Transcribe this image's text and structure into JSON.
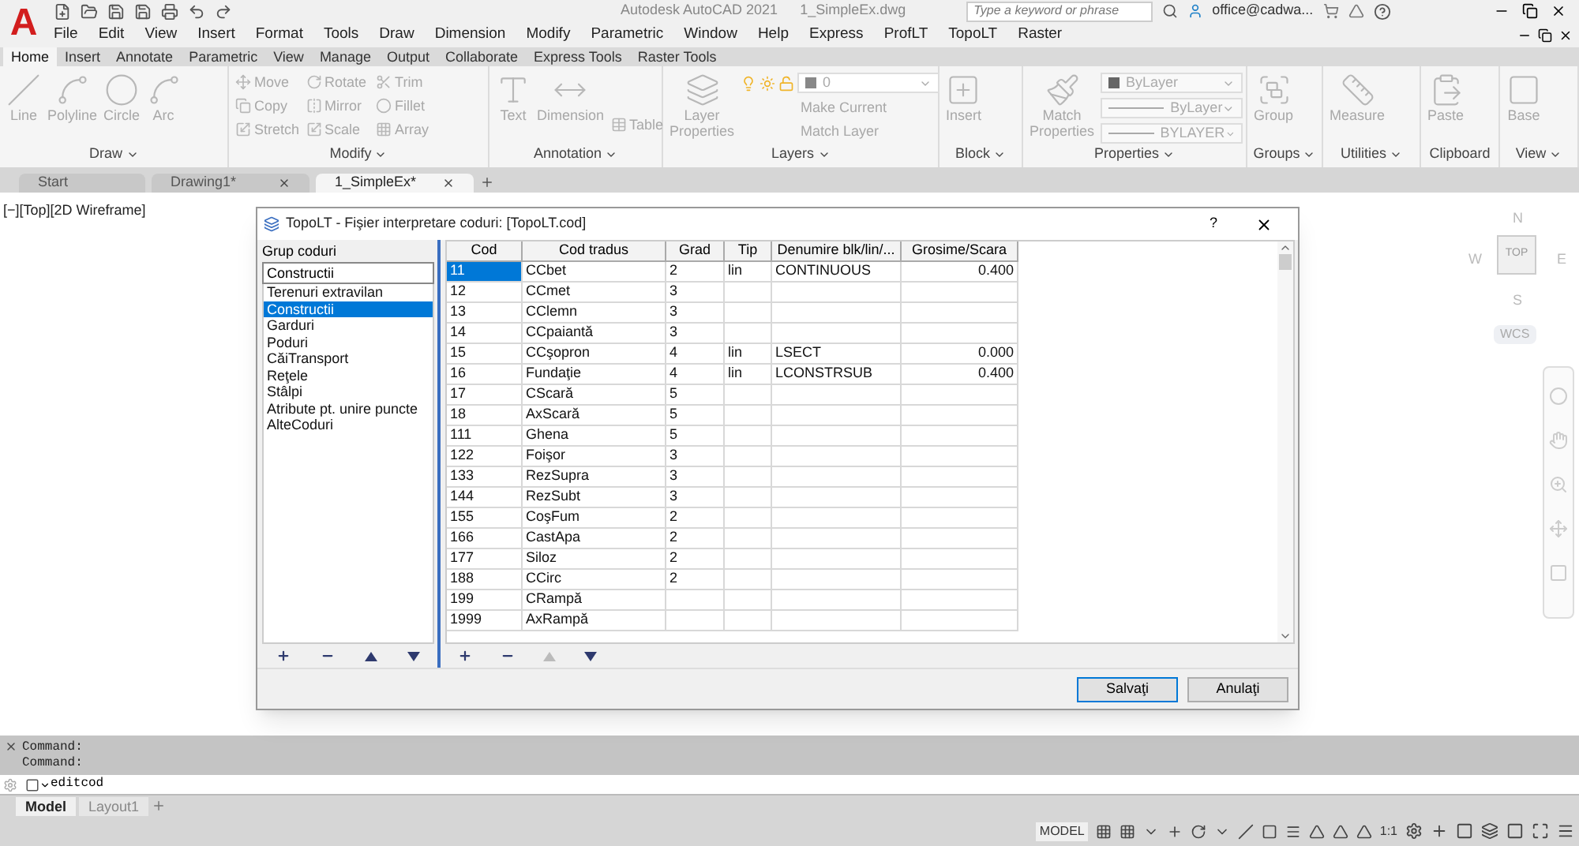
{
  "app": {
    "logo": "A",
    "title": "Autodesk AutoCAD 2021",
    "file": "1_SimpleEx.dwg",
    "search": {
      "placeholder": "Type a keyword or phrase"
    },
    "user": "office@cadwa..."
  },
  "menu": [
    "File",
    "Edit",
    "View",
    "Insert",
    "Format",
    "Tools",
    "Draw",
    "Dimension",
    "Modify",
    "Parametric",
    "Window",
    "Help",
    "Express",
    "ProfLT",
    "TopoLT",
    "Raster"
  ],
  "ribbon": {
    "disabled": true,
    "tabs": [
      {
        "label": "Home",
        "selected": true
      },
      {
        "label": "Insert",
        "selected": false
      },
      {
        "label": "Annotate",
        "selected": false
      },
      {
        "label": "Parametric",
        "selected": false
      },
      {
        "label": "View",
        "selected": false
      },
      {
        "label": "Manage",
        "selected": false
      },
      {
        "label": "Output",
        "selected": false
      },
      {
        "label": "Collaborate",
        "selected": false
      },
      {
        "label": "Express Tools",
        "selected": false
      },
      {
        "label": "Raster Tools",
        "selected": false
      }
    ],
    "panels": [
      {
        "title": "Draw",
        "menu": true,
        "large": [
          "Line",
          "Polyline",
          "Circle",
          "Arc"
        ]
      },
      {
        "title": "Modify",
        "menu": true,
        "small": [
          "Move",
          "Rotate",
          "Trim",
          "Copy",
          "Mirror",
          "Fillet",
          "Stretch",
          "Scale",
          "Array"
        ]
      },
      {
        "title": "Annotation",
        "menu": true,
        "large": [
          "Text",
          "Dimension"
        ],
        "small": [
          "Table"
        ]
      },
      {
        "title": "Layers",
        "menu": true,
        "large": [
          "Layer Properties"
        ],
        "combo": "0",
        "small": [
          "Make Current",
          "Match Layer"
        ]
      },
      {
        "title": "Block",
        "menu": true,
        "large": [
          "Insert"
        ]
      },
      {
        "title": "Properties",
        "menu": true,
        "large": [
          "Match Properties"
        ],
        "combos": [
          "ByLayer",
          "ByLayer",
          "BYLAYER"
        ]
      },
      {
        "title": "Groups",
        "menu": true,
        "large": [
          "Group"
        ]
      },
      {
        "title": "Utilities",
        "menu": true,
        "large": [
          "Measure"
        ]
      },
      {
        "title": "Clipboard",
        "menu": false,
        "large": [
          "Paste"
        ]
      },
      {
        "title": "View",
        "menu": true,
        "large": [
          "Base"
        ]
      }
    ]
  },
  "doc_tabs": [
    {
      "label": "Start",
      "selected": false,
      "closable": false
    },
    {
      "label": "Drawing1*",
      "selected": false,
      "closable": true
    },
    {
      "label": "1_SimpleEx*",
      "selected": true,
      "closable": true
    }
  ],
  "viewport": {
    "label": "[−][Top][2D Wireframe]",
    "viewcube": {
      "n": "N",
      "w": "W",
      "e": "E",
      "s": "S",
      "face": "TOP",
      "ucs": "WCS"
    }
  },
  "dialog": {
    "title": "TopoLT - Fişier interpretare coduri: [TopoLT.cod]",
    "help": "?",
    "group_label": "Grup coduri",
    "group_value": "Constructii",
    "groups": [
      {
        "label": "Terenuri extravilan",
        "selected": false
      },
      {
        "label": "Constructii",
        "selected": true
      },
      {
        "label": "Garduri",
        "selected": false
      },
      {
        "label": "Poduri",
        "selected": false
      },
      {
        "label": "CăiTransport",
        "selected": false
      },
      {
        "label": "Reţele",
        "selected": false
      },
      {
        "label": "Stâlpi",
        "selected": false
      },
      {
        "label": "Atribute pt. unire puncte",
        "selected": false
      },
      {
        "label": "AlteCoduri",
        "selected": false
      }
    ],
    "columns": [
      "Cod",
      "Cod tradus",
      "Grad",
      "Tip",
      "Denumire blk/lin/...",
      "Grosime/Scara"
    ],
    "rows": [
      {
        "cells": [
          "11",
          "CCbet",
          "2",
          "lin",
          "CONTINUOUS",
          "0.400"
        ],
        "selected": true
      },
      {
        "cells": [
          "12",
          "CCmet",
          "3",
          "",
          "",
          ""
        ],
        "selected": false
      },
      {
        "cells": [
          "13",
          "CClemn",
          "3",
          "",
          "",
          ""
        ],
        "selected": false
      },
      {
        "cells": [
          "14",
          "CCpaiantă",
          "3",
          "",
          "",
          ""
        ],
        "selected": false
      },
      {
        "cells": [
          "15",
          "CCşopron",
          "4",
          "lin",
          "LSECT",
          "0.000"
        ],
        "selected": false
      },
      {
        "cells": [
          "16",
          "Fundaţie",
          "4",
          "lin",
          "LCONSTRSUB",
          "0.400"
        ],
        "selected": false
      },
      {
        "cells": [
          "17",
          "CScară",
          "5",
          "",
          "",
          ""
        ],
        "selected": false
      },
      {
        "cells": [
          "18",
          "AxScară",
          "5",
          "",
          "",
          ""
        ],
        "selected": false
      },
      {
        "cells": [
          "111",
          "Ghena",
          "5",
          "",
          "",
          ""
        ],
        "selected": false
      },
      {
        "cells": [
          "122",
          "Foişor",
          "3",
          "",
          "",
          ""
        ],
        "selected": false
      },
      {
        "cells": [
          "133",
          "RezSupra",
          "3",
          "",
          "",
          ""
        ],
        "selected": false
      },
      {
        "cells": [
          "144",
          "RezSubt",
          "3",
          "",
          "",
          ""
        ],
        "selected": false
      },
      {
        "cells": [
          "155",
          "CoşFum",
          "2",
          "",
          "",
          ""
        ],
        "selected": false
      },
      {
        "cells": [
          "166",
          "CastApa",
          "2",
          "",
          "",
          ""
        ],
        "selected": false
      },
      {
        "cells": [
          "177",
          "Siloz",
          "2",
          "",
          "",
          ""
        ],
        "selected": false
      },
      {
        "cells": [
          "188",
          "CCirc",
          "2",
          "",
          "",
          ""
        ],
        "selected": false
      },
      {
        "cells": [
          "199",
          "CRampă",
          "",
          "",
          "",
          ""
        ],
        "selected": false
      },
      {
        "cells": [
          "1999",
          "AxRampă",
          "",
          "",
          "",
          ""
        ],
        "selected": false
      }
    ],
    "buttons": [
      {
        "label": "Salvaţi",
        "default": true
      },
      {
        "label": "Anulaţi",
        "default": false
      }
    ]
  },
  "command": {
    "history": [
      "Command:",
      "Command:"
    ],
    "input": "editcod"
  },
  "layout_tabs": [
    {
      "label": "Model",
      "selected": true
    },
    {
      "label": "Layout1",
      "selected": false
    }
  ],
  "status": {
    "model": "MODEL",
    "scale": "1:1"
  }
}
